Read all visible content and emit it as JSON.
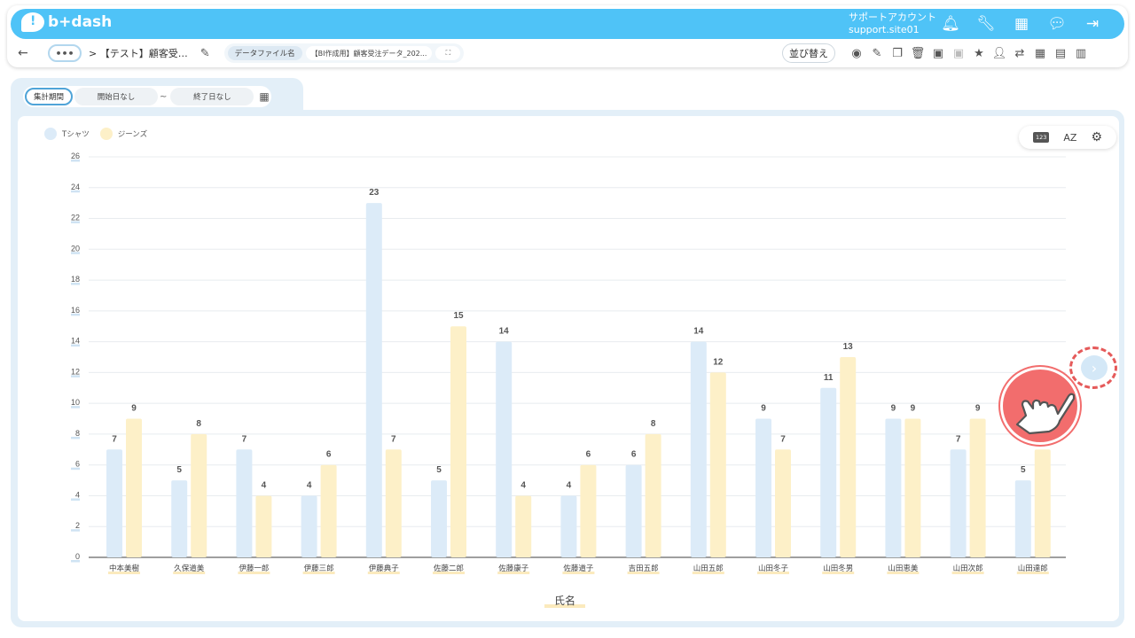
{
  "header": {
    "logo_text": "b+dash",
    "logo_mark": "!",
    "support_title": "サポートアカウント",
    "support_user": "support.site01",
    "icons": [
      "bell-icon",
      "wrench-icon",
      "grid-icon",
      "chat-icon",
      "logout-icon"
    ]
  },
  "toolbar": {
    "more_label": "•••",
    "breadcrumb": "> 【テスト】顧客受…",
    "file_label": "データファイル名",
    "file_name": "【BI作成用】顧客受注データ_202...",
    "expand_label": "⛶",
    "sort_label": "並び替え"
  },
  "filter": {
    "period_label": "集計期間",
    "start_date": "開始日なし",
    "separator": "~",
    "end_date": "終了日なし"
  },
  "chart_tools": {
    "number_chip": "123",
    "az_label": "AZ",
    "settings_icon": "gear-icon"
  },
  "chart_data": {
    "type": "bar",
    "xlabel": "氏名",
    "ylabel": "",
    "ylim": [
      0,
      26
    ],
    "yticks": [
      0,
      2,
      4,
      6,
      8,
      10,
      12,
      14,
      16,
      18,
      20,
      22,
      24,
      26
    ],
    "grid": true,
    "legend_position": "top-left",
    "categories": [
      "中本美樹",
      "久保道美",
      "伊藤一郎",
      "伊藤三郎",
      "伊藤典子",
      "佐藤二郎",
      "佐藤康子",
      "佐藤道子",
      "吉田五郎",
      "山田五郎",
      "山田冬子",
      "山田冬男",
      "山田恵美",
      "山田次郎",
      "山田達郎"
    ],
    "series": [
      {
        "name": "Tシャツ",
        "color": "#dcebf8",
        "values": [
          7,
          5,
          7,
          4,
          23,
          5,
          14,
          4,
          6,
          14,
          9,
          11,
          9,
          7,
          5
        ]
      },
      {
        "name": "ジーンズ",
        "color": "#fdf0c8",
        "values": [
          9,
          8,
          4,
          6,
          7,
          15,
          4,
          6,
          8,
          12,
          7,
          13,
          9,
          9,
          7
        ]
      }
    ],
    "hidden_labels": [
      [
        14,
        1
      ]
    ]
  },
  "colors": {
    "brand": "#4fc3f7",
    "panel": "#e3eff8",
    "accent": "#f26d6d"
  }
}
